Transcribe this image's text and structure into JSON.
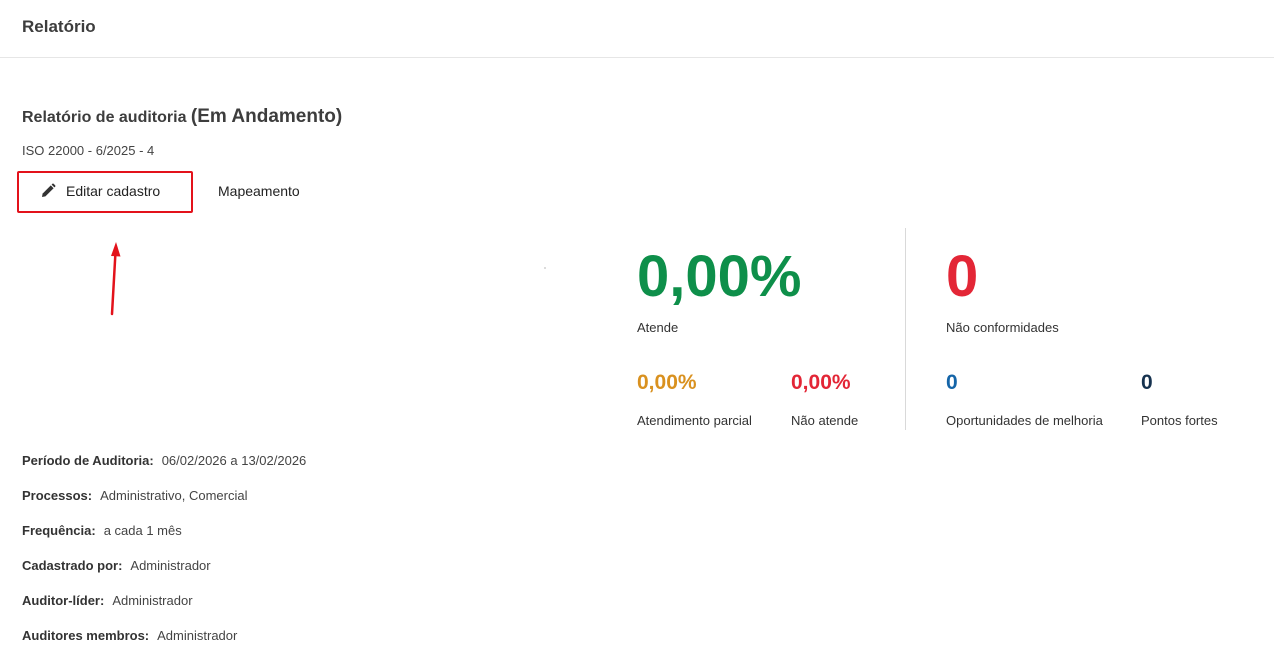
{
  "header": {
    "title": "Relatório"
  },
  "report": {
    "title": "Relatório de auditoria",
    "status": "(Em Andamento)",
    "subtitle": "ISO 22000 - 6/2025 - 4"
  },
  "actions": {
    "edit_label": "Editar cadastro",
    "mapping_label": "Mapeamento"
  },
  "stats": {
    "atende": {
      "value": "0,00%",
      "label": "Atende",
      "color": "#0e8f4a"
    },
    "nao_conformidades": {
      "value": "0",
      "label": "Não conformidades",
      "color": "#e32636"
    },
    "atendimento_parcial": {
      "value": "0,00%",
      "label": "Atendimento parcial",
      "color": "#d9911f"
    },
    "nao_atende": {
      "value": "0,00%",
      "label": "Não atende",
      "color": "#e32636"
    },
    "oportunidades": {
      "value": "0",
      "label": "Oportunidades de melhoria",
      "color": "#1565a8"
    },
    "pontos_fortes": {
      "value": "0",
      "label": "Pontos fortes",
      "color": "#16324f"
    }
  },
  "details": [
    {
      "label": "Período de Auditoria:",
      "value": "06/02/2026 a 13/02/2026"
    },
    {
      "label": "Processos:",
      "value": "Administrativo, Comercial"
    },
    {
      "label": "Frequência:",
      "value": "a cada 1 mês"
    },
    {
      "label": "Cadastrado por:",
      "value": "Administrador"
    },
    {
      "label": "Auditor-líder:",
      "value": "Administrador"
    },
    {
      "label": "Auditores membros:",
      "value": "Administrador"
    }
  ],
  "icons": {
    "edit": "pencil-icon",
    "annotation": "arrow-up-icon"
  },
  "colors": {
    "highlight": "#e3121b"
  }
}
